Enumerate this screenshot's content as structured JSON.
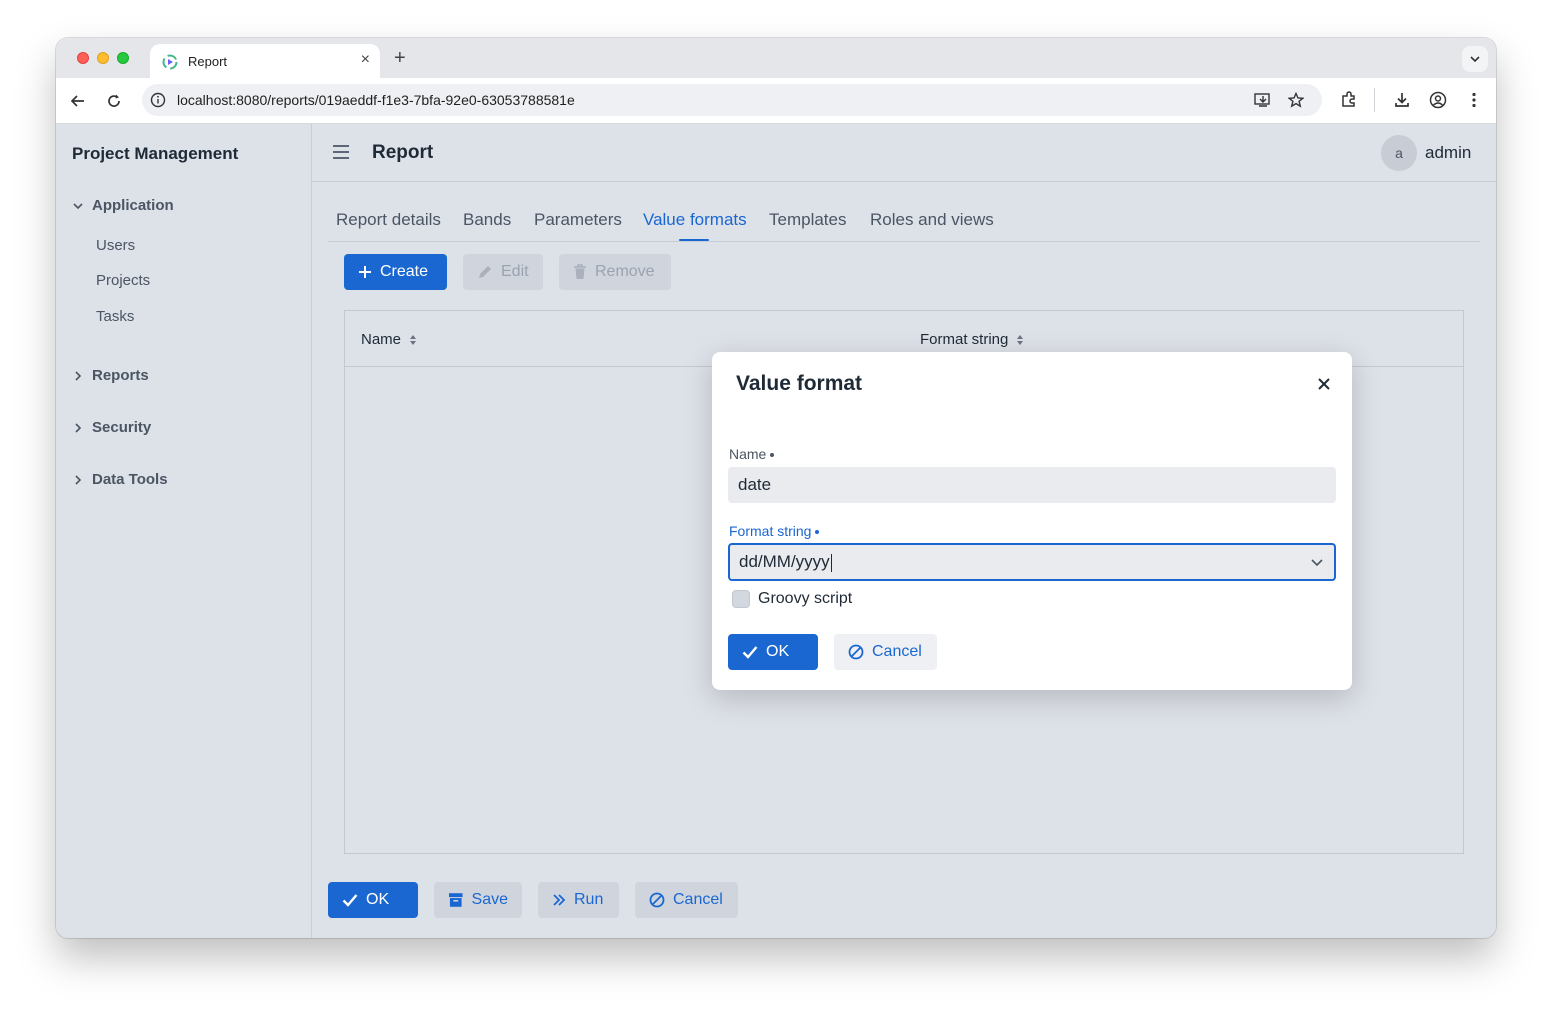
{
  "browser": {
    "tab_title": "Report",
    "tab_close": "×",
    "new_tab": "+",
    "url": "localhost:8080/reports/019aeddf-f1e3-7bfa-92e0-63053788581e"
  },
  "sidebar": {
    "brand": "Project Management",
    "groups": [
      {
        "label": "Application",
        "expanded": true,
        "items": [
          "Users",
          "Projects",
          "Tasks"
        ]
      },
      {
        "label": "Reports",
        "expanded": false
      },
      {
        "label": "Security",
        "expanded": false
      },
      {
        "label": "Data Tools",
        "expanded": false
      }
    ]
  },
  "header": {
    "title": "Report",
    "avatar_letter": "a",
    "username": "admin"
  },
  "tabs": [
    {
      "label": "Report details",
      "active": false
    },
    {
      "label": "Bands",
      "active": false
    },
    {
      "label": "Parameters",
      "active": false
    },
    {
      "label": "Value formats",
      "active": true
    },
    {
      "label": "Templates",
      "active": false
    },
    {
      "label": "Roles and views",
      "active": false
    }
  ],
  "grid_toolbar": {
    "create": "Create",
    "edit": "Edit",
    "remove": "Remove"
  },
  "grid": {
    "columns": [
      "Name",
      "Format string"
    ]
  },
  "dialog": {
    "title": "Value format",
    "name_label": "Name",
    "name_value": "date",
    "format_label": "Format string",
    "format_value": "dd/MM/yyyy",
    "groovy_label": "Groovy script",
    "groovy_checked": false,
    "ok": "OK",
    "cancel": "Cancel"
  },
  "footer": {
    "ok": "OK",
    "save": "Save",
    "run": "Run",
    "cancel": "Cancel"
  },
  "colors": {
    "primary": "#1a67d2",
    "background": "#dde1e8"
  }
}
